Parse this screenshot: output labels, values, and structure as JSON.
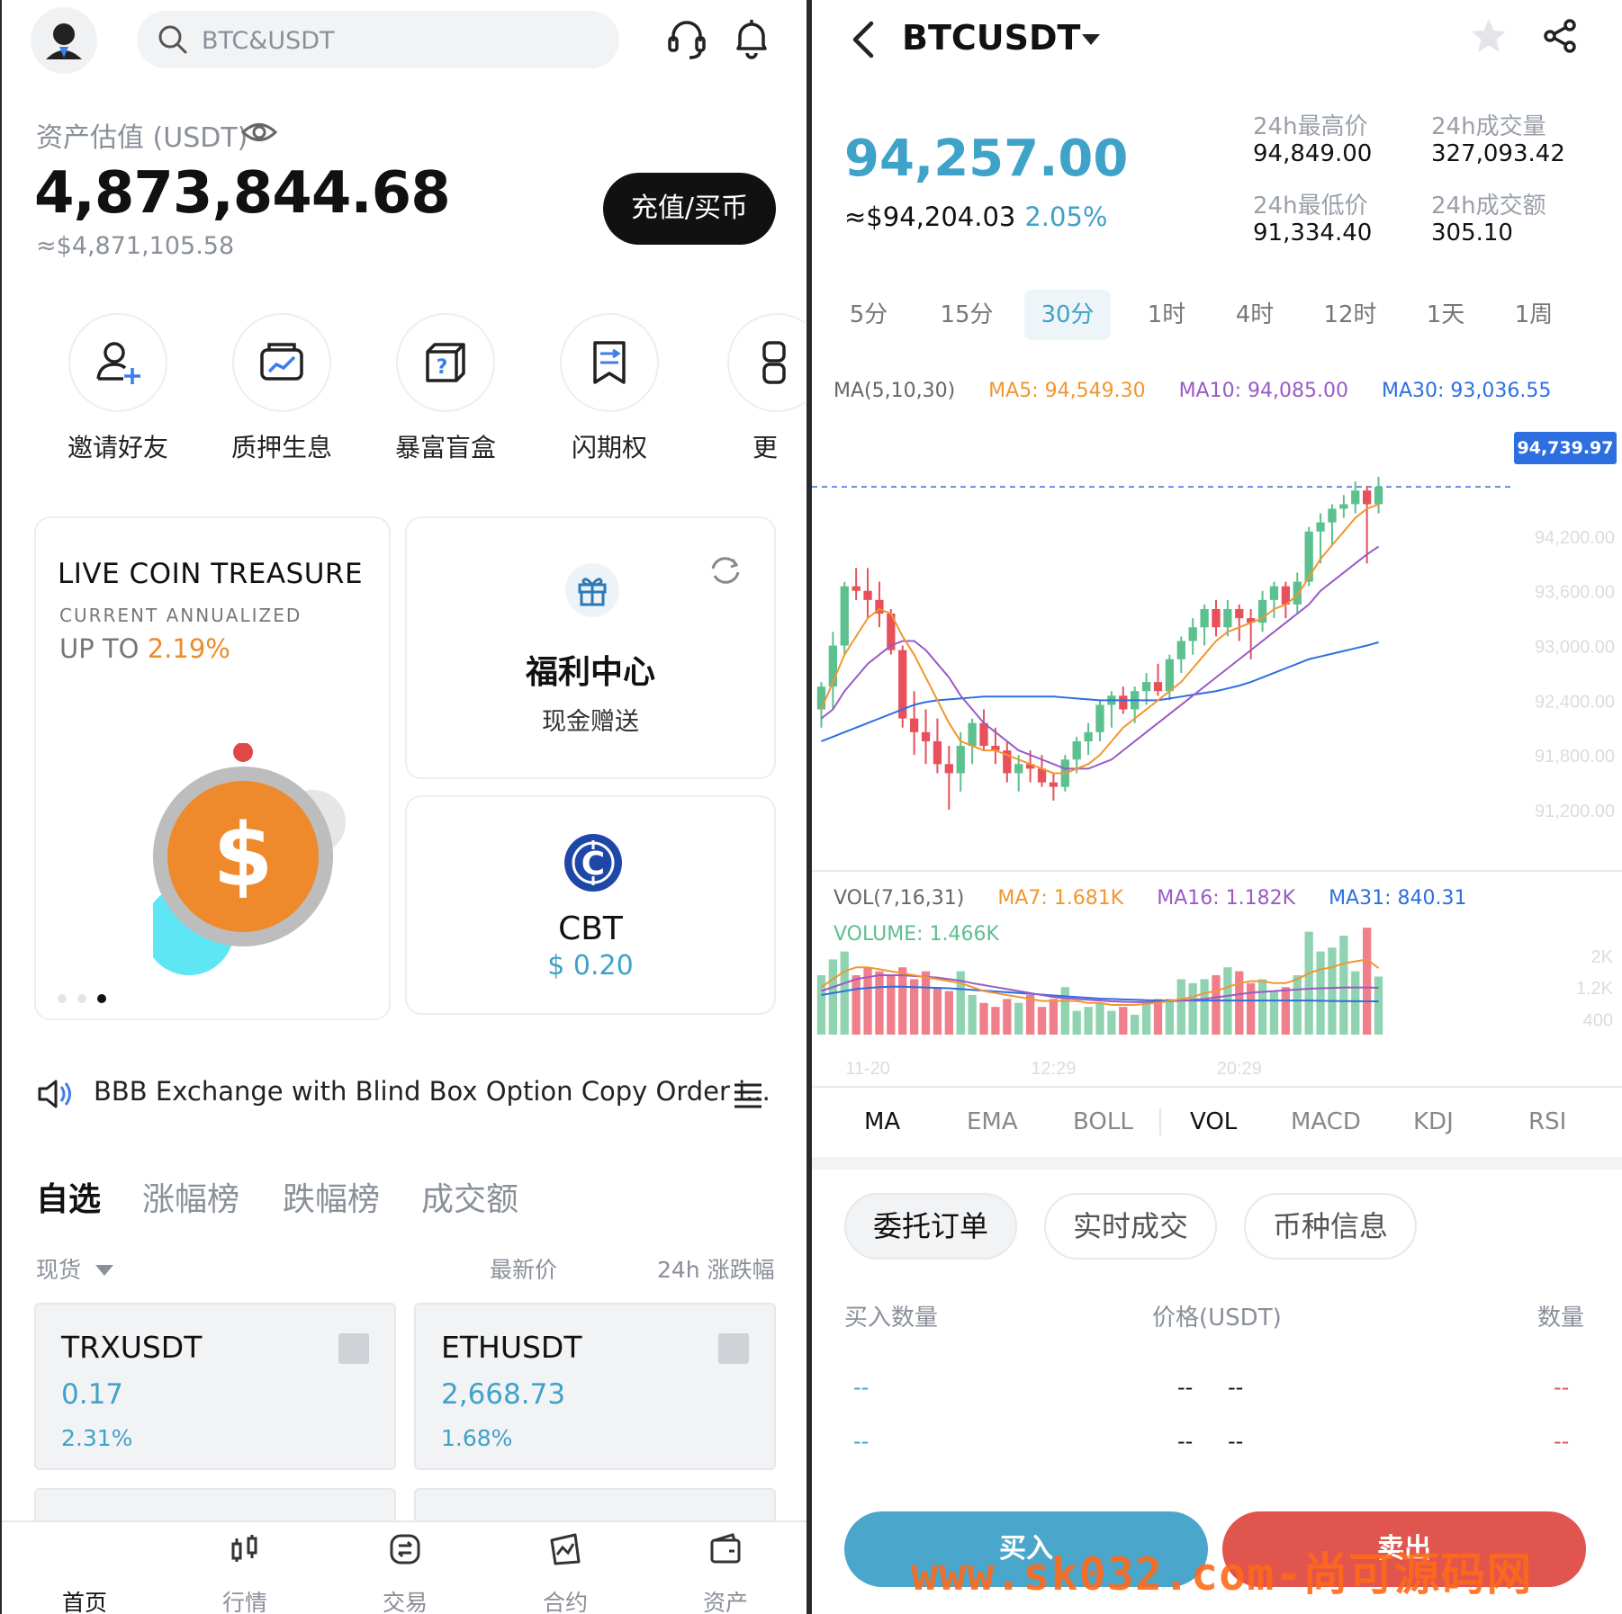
{
  "left": {
    "header": {
      "search_placeholder": "BTC&USDT"
    },
    "assets": {
      "label": "资产估值 (USDT)",
      "value": "4,873,844.68",
      "usd": "≈$4,871,105.58",
      "deposit_button": "充值/买币"
    },
    "quick_actions": [
      {
        "label": "邀请好友",
        "icon": "invite-friend-icon"
      },
      {
        "label": "质押生息",
        "icon": "staking-icon"
      },
      {
        "label": "暴富盲盒",
        "icon": "blind-box-icon"
      },
      {
        "label": "闪期权",
        "icon": "flash-option-icon"
      },
      {
        "label": "更",
        "icon": "more-icon"
      }
    ],
    "treasure": {
      "title": "LIVE COIN TREASURE",
      "subtitle": "CURRENT ANNUALIZED",
      "rate_label": "UP TO ",
      "rate": "2.19%"
    },
    "welfare": {
      "title": "福利中心",
      "subtitle": "现金赠送"
    },
    "cbt": {
      "name": "CBT",
      "price": "$ 0.20"
    },
    "notice": "BBB Exchange with Blind Box Option Copy Order i...",
    "market_tabs": [
      "自选",
      "涨幅榜",
      "跌幅榜",
      "成交额"
    ],
    "list_header": {
      "type": "现货",
      "price": "最新价",
      "change": "24h 涨跌幅"
    },
    "pairs": [
      {
        "name": "TRXUSDT",
        "price": "0.17",
        "change": "2.31%"
      },
      {
        "name": "ETHUSDT",
        "price": "2,668.73",
        "change": "1.68%"
      }
    ],
    "bottom_nav": [
      "首页",
      "行情",
      "交易",
      "合约",
      "资产"
    ]
  },
  "right": {
    "pair": "BTCUSDT",
    "price": "94,257.00",
    "approx": "≈$94,204.03",
    "change": "2.05%",
    "stats": {
      "high_label": "24h最高价",
      "high": "94,849.00",
      "low_label": "24h最低价",
      "low": "91,334.40",
      "vol_label": "24h成交量",
      "vol": "327,093.42",
      "amount_label": "24h成交额",
      "amount": "305.10"
    },
    "timeframes": [
      "5分",
      "15分",
      "30分",
      "1时",
      "4时",
      "12时",
      "1天",
      "1周"
    ],
    "active_timeframe": "30分",
    "ma_legend": {
      "title": "MA(5,10,30)",
      "ma5": "MA5: 94,549.30",
      "ma10": "MA10: 94,085.00",
      "ma30": "MA30: 93,036.55"
    },
    "vol_legend": {
      "title": "VOL(7,16,31)",
      "ma7": "MA7: 1.681K",
      "ma16": "MA16: 1.182K",
      "ma31": "MA31: 840.31",
      "volume": "VOLUME: 1.466K"
    },
    "current_price_tag": "94,739.97",
    "indicators": [
      "MA",
      "EMA",
      "BOLL",
      "VOL",
      "MACD",
      "KDJ",
      "RSI"
    ],
    "order_tabs": [
      "委托订单",
      "实时成交",
      "币种信息"
    ],
    "orderbook_header": {
      "buy_qty": "买入数量",
      "price": "价格(USDT)",
      "qty": "数量"
    },
    "orderbook_placeholder": "--",
    "buy_button": "买入",
    "sell_button": "卖出",
    "watermark": "www.sk032.com-尚可源码网",
    "colors": {
      "up": "#5cc08f",
      "down": "#e8505b",
      "ma5": "#f2962f",
      "ma10": "#9a5ac6",
      "ma30": "#2d6fe0"
    }
  },
  "chart_data": {
    "type": "candlestick",
    "y_ticks": [
      "94,200.00",
      "93,600.00",
      "93,000.00",
      "92,400.00",
      "91,800.00",
      "91,200.00"
    ],
    "ylim": [
      91200,
      94850
    ],
    "x_ticks": [
      "11-20",
      "12:29",
      "20:29"
    ],
    "candles": [
      [
        92300,
        92600,
        92100,
        92550
      ],
      [
        92550,
        93150,
        92300,
        93000
      ],
      [
        93000,
        93700,
        92900,
        93650
      ],
      [
        93650,
        93850,
        93500,
        93600
      ],
      [
        93600,
        93850,
        93300,
        93500
      ],
      [
        93500,
        93700,
        93200,
        93350
      ],
      [
        93350,
        93400,
        92900,
        92950
      ],
      [
        92950,
        93000,
        92100,
        92200
      ],
      [
        92200,
        92500,
        91800,
        92050
      ],
      [
        92050,
        92300,
        91700,
        91950
      ],
      [
        91950,
        92200,
        91600,
        91700
      ],
      [
        91700,
        91900,
        91200,
        91600
      ],
      [
        91600,
        92050,
        91400,
        91900
      ],
      [
        91900,
        92200,
        91700,
        92150
      ],
      [
        92150,
        92300,
        91850,
        91900
      ],
      [
        91900,
        92100,
        91700,
        91850
      ],
      [
        91850,
        91950,
        91500,
        91600
      ],
      [
        91600,
        91800,
        91400,
        91700
      ],
      [
        91700,
        91850,
        91500,
        91650
      ],
      [
        91650,
        91800,
        91450,
        91500
      ],
      [
        91500,
        91600,
        91300,
        91450
      ],
      [
        91450,
        91800,
        91400,
        91750
      ],
      [
        91750,
        92000,
        91600,
        91950
      ],
      [
        91950,
        92150,
        91800,
        92050
      ],
      [
        92050,
        92400,
        91950,
        92350
      ],
      [
        92350,
        92500,
        92100,
        92450
      ],
      [
        92450,
        92550,
        92250,
        92300
      ],
      [
        92300,
        92550,
        92150,
        92500
      ],
      [
        92500,
        92700,
        92350,
        92600
      ],
      [
        92600,
        92800,
        92450,
        92500
      ],
      [
        92500,
        92900,
        92400,
        92850
      ],
      [
        92850,
        93100,
        92700,
        93050
      ],
      [
        93050,
        93300,
        92900,
        93200
      ],
      [
        93200,
        93450,
        93000,
        93400
      ],
      [
        93400,
        93500,
        93100,
        93200
      ],
      [
        93200,
        93500,
        93100,
        93400
      ],
      [
        93400,
        93450,
        93050,
        93300
      ],
      [
        93300,
        93400,
        92850,
        93250
      ],
      [
        93250,
        93600,
        93150,
        93500
      ],
      [
        93500,
        93700,
        93300,
        93650
      ],
      [
        93650,
        93700,
        93300,
        93450
      ],
      [
        93450,
        93800,
        93350,
        93700
      ],
      [
        93700,
        94300,
        93650,
        94250
      ],
      [
        94250,
        94450,
        93900,
        94350
      ],
      [
        94350,
        94550,
        94100,
        94500
      ],
      [
        94500,
        94650,
        94400,
        94550
      ],
      [
        94550,
        94800,
        94450,
        94700
      ],
      [
        94700,
        94750,
        93900,
        94550
      ],
      [
        94550,
        94850,
        94450,
        94740
      ]
    ],
    "ma5": [
      92300,
      92600,
      92900,
      93100,
      93300,
      93400,
      93350,
      93100,
      92900,
      92650,
      92400,
      92150,
      91950,
      91900,
      91850,
      91850,
      91800,
      91750,
      91700,
      91650,
      91600,
      91600,
      91650,
      91700,
      91800,
      91950,
      92100,
      92200,
      92300,
      92400,
      92500,
      92600,
      92750,
      92900,
      93050,
      93150,
      93200,
      93250,
      93300,
      93400,
      93450,
      93550,
      93750,
      93950,
      94100,
      94250,
      94400,
      94500,
      94549
    ],
    "ma10": [
      92200,
      92300,
      92500,
      92650,
      92800,
      92900,
      93000,
      93050,
      93050,
      92950,
      92800,
      92650,
      92450,
      92300,
      92150,
      92050,
      91950,
      91850,
      91800,
      91750,
      91700,
      91650,
      91650,
      91650,
      91700,
      91750,
      91850,
      91950,
      92050,
      92150,
      92250,
      92350,
      92450,
      92550,
      92650,
      92750,
      92850,
      92950,
      93050,
      93150,
      93250,
      93350,
      93450,
      93600,
      93700,
      93800,
      93900,
      94000,
      94085
    ],
    "ma30": [
      91950,
      92000,
      92050,
      92100,
      92150,
      92200,
      92250,
      92300,
      92350,
      92380,
      92400,
      92410,
      92420,
      92430,
      92440,
      92440,
      92440,
      92440,
      92440,
      92440,
      92440,
      92430,
      92420,
      92410,
      92400,
      92400,
      92400,
      92400,
      92400,
      92400,
      92420,
      92440,
      92460,
      92480,
      92500,
      92530,
      92560,
      92600,
      92650,
      92700,
      92750,
      92800,
      92850,
      92880,
      92910,
      92940,
      92970,
      93000,
      93036
    ],
    "volume_ticks": [
      "2K",
      "1.2K",
      "400"
    ],
    "volume_max": 2500,
    "volume": [
      1500,
      1900,
      2100,
      1500,
      1700,
      1600,
      1500,
      1700,
      1400,
      1600,
      1200,
      1100,
      1600,
      1000,
      800,
      700,
      900,
      800,
      1000,
      700,
      900,
      1200,
      600,
      700,
      800,
      600,
      700,
      500,
      800,
      900,
      900,
      1400,
      1300,
      1400,
      1500,
      1700,
      1600,
      1300,
      1400,
      1100,
      1200,
      1500,
      2600,
      2100,
      2200,
      2500,
      1600,
      2700,
      1466
    ],
    "vol_up_down": "from candles",
    "vol_ma7": [
      1200,
      1400,
      1600,
      1700,
      1700,
      1650,
      1600,
      1550,
      1500,
      1450,
      1400,
      1350,
      1300,
      1200,
      1100,
      1050,
      1000,
      950,
      900,
      850,
      850,
      850,
      850,
      800,
      800,
      750,
      750,
      750,
      780,
      800,
      850,
      900,
      950,
      1050,
      1100,
      1200,
      1300,
      1350,
      1350,
      1300,
      1300,
      1400,
      1550,
      1650,
      1700,
      1800,
      1850,
      1900,
      1681
    ],
    "vol_ma16": [
      1100,
      1200,
      1300,
      1400,
      1450,
      1500,
      1500,
      1500,
      1480,
      1460,
      1440,
      1400,
      1360,
      1300,
      1250,
      1200,
      1150,
      1100,
      1050,
      1000,
      950,
      920,
      900,
      880,
      860,
      840,
      830,
      820,
      820,
      830,
      840,
      860,
      880,
      900,
      940,
      980,
      1020,
      1060,
      1080,
      1100,
      1120,
      1140,
      1160,
      1170,
      1180,
      1190,
      1190,
      1190,
      1182
    ],
    "vol_ma31": [
      1000,
      1050,
      1100,
      1150,
      1180,
      1200,
      1210,
      1210,
      1200,
      1190,
      1180,
      1170,
      1150,
      1130,
      1110,
      1090,
      1070,
      1050,
      1030,
      1010,
      990,
      970,
      950,
      930,
      910,
      900,
      890,
      880,
      870,
      860,
      860,
      860,
      860,
      860,
      860,
      860,
      860,
      860,
      860,
      860,
      860,
      860,
      860,
      855,
      850,
      848,
      845,
      842,
      840
    ]
  }
}
